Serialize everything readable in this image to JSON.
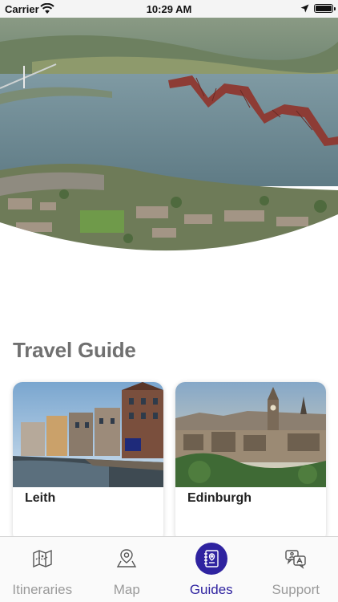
{
  "status_bar": {
    "carrier": "Carrier",
    "time": "10:29 AM",
    "icons": [
      "wifi-icon",
      "location-arrow-icon",
      "battery-icon"
    ]
  },
  "hero": {
    "image": "aerial photo of Firth of Forth with Forth Bridge"
  },
  "section": {
    "title": "Travel Guide"
  },
  "guides": [
    {
      "label": "Leith",
      "image": "waterfront buildings along the Shore, Leith"
    },
    {
      "label": "Edinburgh",
      "image": "Edinburgh skyline with Balmoral clock tower and castle"
    }
  ],
  "tabs": [
    {
      "label": "Itineraries",
      "icon": "folded-map-icon",
      "active": false
    },
    {
      "label": "Map",
      "icon": "map-pin-icon",
      "active": false
    },
    {
      "label": "Guides",
      "icon": "guidebook-icon",
      "active": true
    },
    {
      "label": "Support",
      "icon": "chat-bubbles-icon",
      "active": false
    }
  ],
  "colors": {
    "accent": "#2f23a0",
    "title_gray": "#707070",
    "tab_inactive": "#9a9a9a",
    "status_bar_bg": "#f4f4f4"
  }
}
